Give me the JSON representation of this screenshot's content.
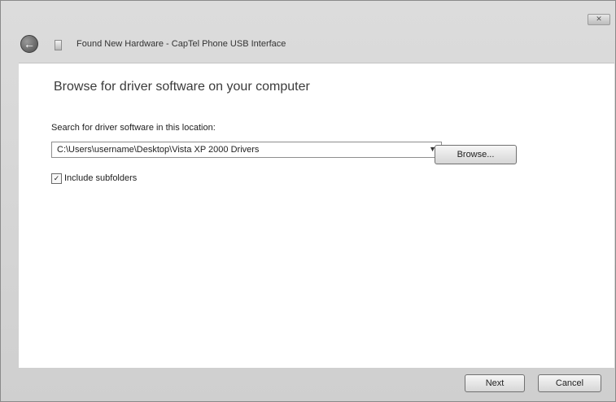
{
  "window": {
    "close_symbol": "✕"
  },
  "titlebar": {
    "back_icon": "back-arrow-icon",
    "back_glyph": "←",
    "device_icon": "device-icon",
    "title": "Found New Hardware - CapTel Phone USB Interface"
  },
  "content": {
    "heading": "Browse for driver software on your computer",
    "search_label": "Search for driver software in this location:",
    "path_value": "C:\\Users\\username\\Desktop\\Vista XP 2000 Drivers",
    "browse_label": "Browse...",
    "include_subfolders": {
      "label": "Include subfolders",
      "checked": true,
      "check_glyph": "✓"
    }
  },
  "footer": {
    "next_label": "Next",
    "cancel_label": "Cancel"
  },
  "colors": {
    "chrome": "#d6d6d6",
    "content_bg": "#ffffff",
    "heading_text": "#3b3b3b"
  }
}
